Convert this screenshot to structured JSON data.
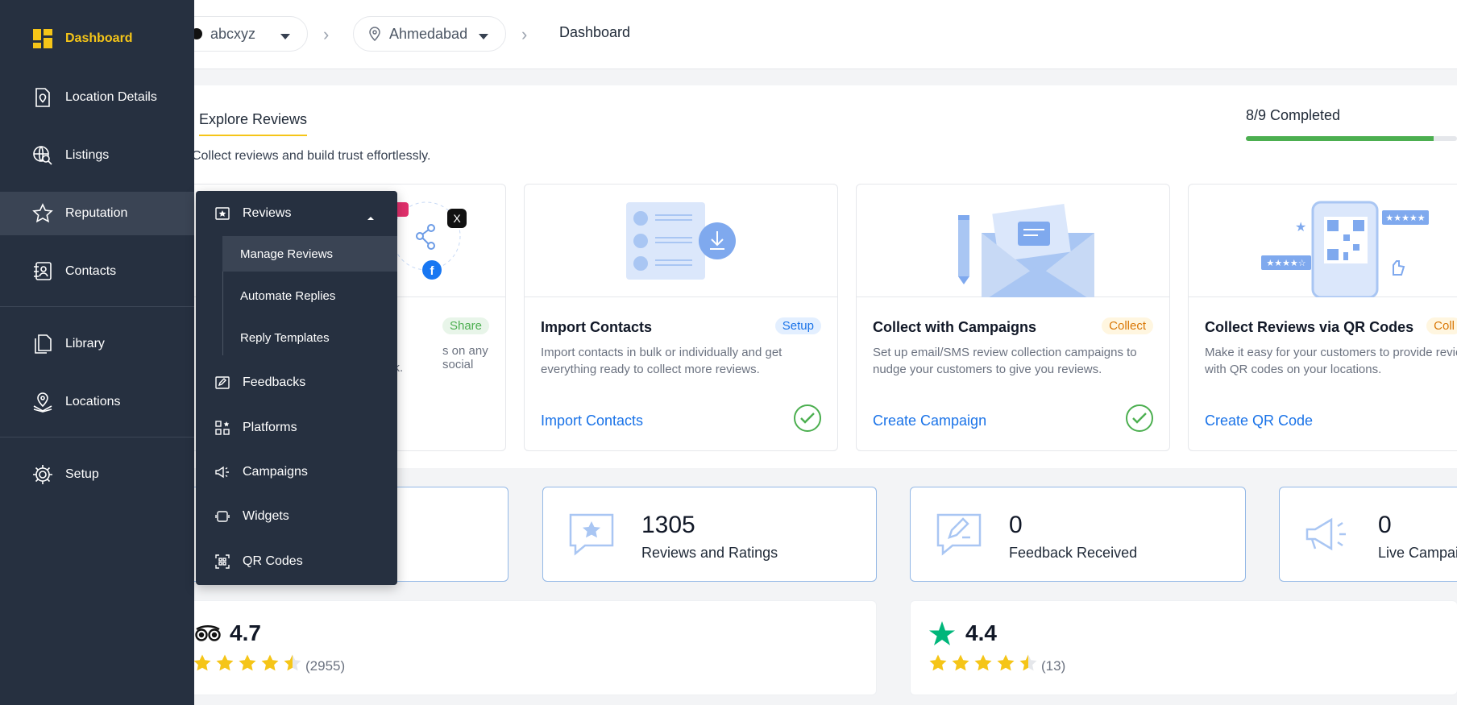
{
  "sidebar": {
    "items": [
      {
        "label": "Dashboard",
        "icon": "grid-icon"
      },
      {
        "label": "Location Details",
        "icon": "location-doc-icon"
      },
      {
        "label": "Listings",
        "icon": "globe-search-icon"
      },
      {
        "label": "Reputation",
        "icon": "star-icon"
      },
      {
        "label": "Contacts",
        "icon": "contact-book-icon"
      },
      {
        "label": "Library",
        "icon": "files-icon"
      },
      {
        "label": "Locations",
        "icon": "map-pin-icon"
      },
      {
        "label": "Setup",
        "icon": "gear-icon"
      }
    ]
  },
  "breadcrumb": {
    "account": "abcxyz",
    "location": "Ahmedabad",
    "page": "Dashboard"
  },
  "explore": {
    "tab": "Explore Reviews",
    "subtitle": "Collect reviews and build trust effortlessly.",
    "completed": "8/9 Completed",
    "progress_fraction": 0.889
  },
  "cards": [
    {
      "tag": "Share",
      "desc_fragment_1": "s on any social",
      "desc_fragment_2": "ck."
    },
    {
      "title": "Import Contacts",
      "tag": "Setup",
      "desc": "Import contacts in bulk or individually and get everything ready to collect more reviews.",
      "link": "Import Contacts",
      "done": true
    },
    {
      "title": "Collect with Campaigns",
      "tag": "Collect",
      "desc": "Set up email/SMS review collection campaigns to nudge your customers to give you reviews.",
      "link": "Create Campaign",
      "done": true
    },
    {
      "title": "Collect Reviews via QR Codes",
      "tag": "Coll",
      "desc": "Make it easy for your customers to provide reviews with QR codes on your locations.",
      "link": "Create QR Code",
      "done": false
    }
  ],
  "stats": [
    {
      "value": "1305",
      "label": "Reviews and Ratings"
    },
    {
      "value": "0",
      "label": "Feedback Received"
    },
    {
      "value": "0",
      "label": "Live Campai"
    }
  ],
  "ratings": [
    {
      "score": "4.7",
      "count": "(2955)",
      "stars": 4.5
    },
    {
      "score": "4.4",
      "count": "(13)",
      "stars": 4.5
    }
  ],
  "menu": {
    "reviews": "Reviews",
    "sub": [
      "Manage Reviews",
      "Automate Replies",
      "Reply Templates"
    ],
    "items": [
      "Feedbacks",
      "Platforms",
      "Campaigns",
      "Widgets",
      "QR Codes"
    ]
  },
  "colors": {
    "sidebar_bg": "#263040",
    "accent_yellow": "#f5c518",
    "link_blue": "#1a73e8",
    "success_green": "#4caf50"
  }
}
